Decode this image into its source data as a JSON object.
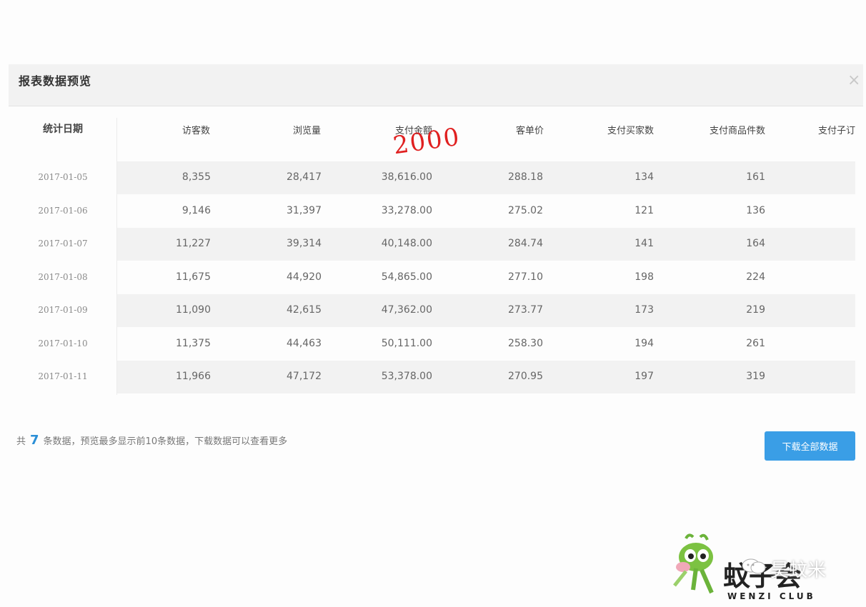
{
  "modal": {
    "title": "报表数据预览",
    "close_symbol": "×"
  },
  "table": {
    "date_header": "统计日期",
    "headers": [
      "访客数",
      "浏览量",
      "支付金额",
      "客单价",
      "支付买家数",
      "支付商品件数",
      "支付子订"
    ],
    "rows": [
      {
        "date": "2017-01-05",
        "values": [
          "8,355",
          "28,417",
          "38,616.00",
          "288.18",
          "134",
          "161"
        ]
      },
      {
        "date": "2017-01-06",
        "values": [
          "9,146",
          "31,397",
          "33,278.00",
          "275.02",
          "121",
          "136"
        ]
      },
      {
        "date": "2017-01-07",
        "values": [
          "11,227",
          "39,314",
          "40,148.00",
          "284.74",
          "141",
          "164"
        ]
      },
      {
        "date": "2017-01-08",
        "values": [
          "11,675",
          "44,920",
          "54,865.00",
          "277.10",
          "198",
          "224"
        ]
      },
      {
        "date": "2017-01-09",
        "values": [
          "11,090",
          "42,615",
          "47,362.00",
          "273.77",
          "173",
          "219"
        ]
      },
      {
        "date": "2017-01-10",
        "values": [
          "11,375",
          "44,463",
          "50,111.00",
          "258.30",
          "194",
          "261"
        ]
      },
      {
        "date": "2017-01-11",
        "values": [
          "11,966",
          "47,172",
          "53,378.00",
          "270.95",
          "197",
          "319"
        ]
      }
    ]
  },
  "annotation": {
    "handwritten": "2000",
    "color": "#e02020"
  },
  "footer": {
    "prefix": "共",
    "count": "7",
    "suffix": "条数据，预览最多显示前10条数据，下载数据可以查看更多",
    "download_label": "下载全部数据"
  },
  "watermark": {
    "brand_cn": "蚊子会",
    "brand_en": "WENZI CLUB",
    "author": "昊蚊米"
  },
  "colors": {
    "primary": "#3a9ee6",
    "row_alt": "#f2f2f2",
    "header_bg": "#f2f2f2"
  }
}
